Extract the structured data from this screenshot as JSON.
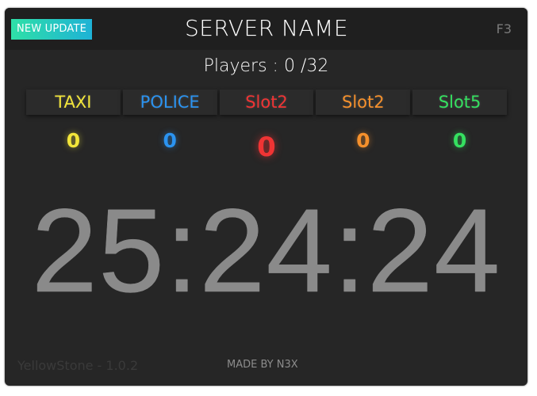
{
  "header": {
    "update_label": "NEW UPDATE",
    "server_name": "SERVER NAME",
    "hotkey": "F3"
  },
  "players": {
    "text": "Players : 0  /32"
  },
  "teams": [
    {
      "name": "TAXI",
      "count": "0",
      "color": "#f2e53a"
    },
    {
      "name": "POLICE",
      "count": "0",
      "color": "#2b93f0"
    },
    {
      "name": "Slot2",
      "count": "0",
      "color": "#f03434"
    },
    {
      "name": "Slot2",
      "count": "0",
      "color": "#f5902c"
    },
    {
      "name": "Slot5",
      "count": "0",
      "color": "#35e060"
    }
  ],
  "clock": {
    "time": "25:24:24"
  },
  "footer": {
    "version": "YellowStone - 1.0.2",
    "credit": "MADE BY N3X"
  },
  "colors": {
    "panel_bg": "#262626",
    "header_bg": "#1f1f1f",
    "update_gradient_start": "#2fe0a7",
    "update_gradient_end": "#1eb2d6",
    "clock": "#8a8a8a"
  }
}
